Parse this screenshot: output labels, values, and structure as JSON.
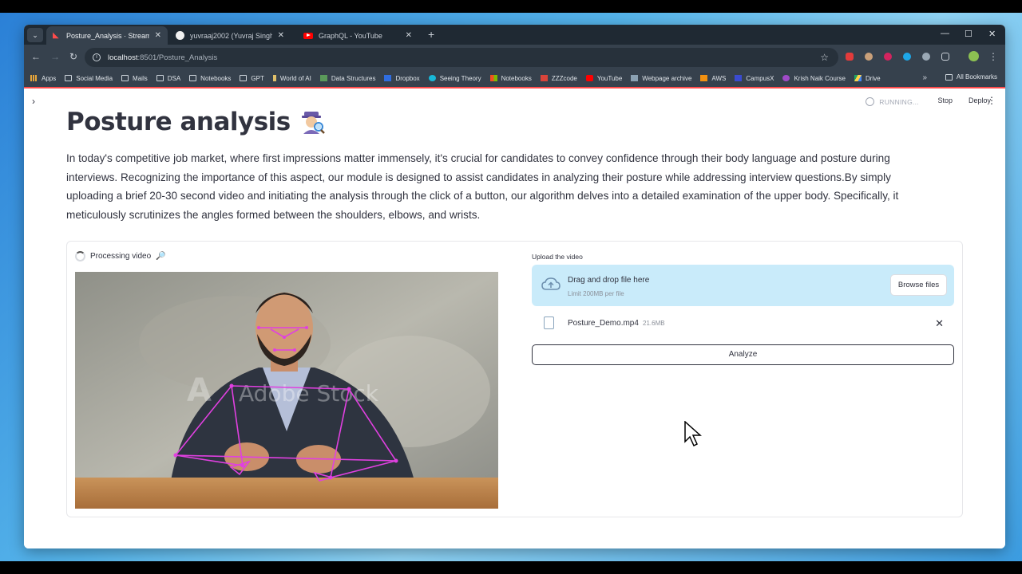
{
  "browser": {
    "tabs": [
      {
        "title": "Posture_Analysis · Streamlit",
        "active": true,
        "favicon": "streamlit-icon"
      },
      {
        "title": "yuvraaj2002 (Yuvraj Singh)",
        "active": false,
        "favicon": "github-icon"
      },
      {
        "title": "GraphQL - YouTube",
        "active": false,
        "favicon": "youtube-icon"
      }
    ],
    "url_host": "localhost",
    "url_rest": ":8501/Posture_Analysis",
    "bookmarks": [
      "Apps",
      "Social Media",
      "Mails",
      "DSA",
      "Notebooks",
      "GPT",
      "World of AI",
      "Data Structures",
      "Dropbox",
      "Seeing Theory",
      "Notebooks",
      "ZZZcode",
      "YouTube",
      "Webpage archive",
      "AWS",
      "CampusX",
      "Krish Naik Course",
      "Drive"
    ],
    "all_bookmarks": "All Bookmarks"
  },
  "streamlit": {
    "status": "RUNNING...",
    "stop": "Stop",
    "deploy": "Deploy"
  },
  "page": {
    "title": "Posture analysis",
    "intro": "In today's competitive job market, where first impressions matter immensely, it's crucial for candidates to convey confidence through their body language and posture during interviews. Recognizing the importance of this aspect, our module is designed to assist candidates in analyzing their posture while addressing interview questions.By simply uploading a brief 20-30 second video and initiating the analysis through the click of a button, our algorithm delves into a detailed examination of the upper body. Specifically, it meticulously scrutinizes the angles formed between the shoulders, elbows, and wrists.",
    "processing": "Processing video",
    "video_watermark": "Adobe Stock",
    "upload_label": "Upload the video",
    "dropzone_title": "Drag and drop file here",
    "dropzone_limit": "Limit 200MB per file",
    "browse_button": "Browse files",
    "file_name": "Posture_Demo.mp4",
    "file_size": "21.6MB",
    "analyze_button": "Analyze"
  },
  "colors": {
    "streamlit_red": "#ff4b4b",
    "dropzone_bg": "#c9ebfa",
    "pose_overlay": "#e040e0"
  }
}
